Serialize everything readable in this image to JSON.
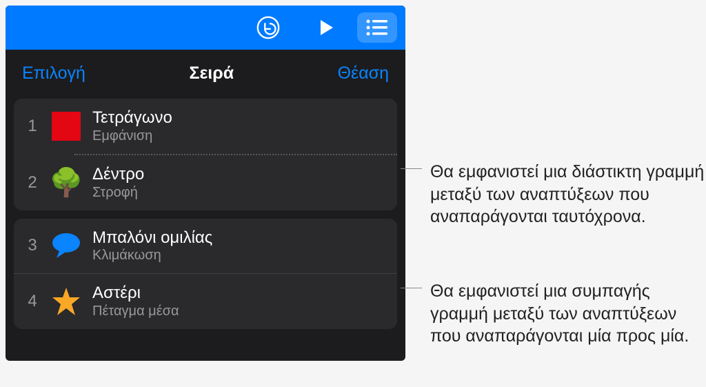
{
  "subheader": {
    "left": "Επιλογή",
    "center": "Σειρά",
    "right": "Θέαση"
  },
  "items": [
    {
      "number": "1",
      "title": "Τετράγωνο",
      "subtitle": "Εμφάνιση"
    },
    {
      "number": "2",
      "title": "Δέντρο",
      "subtitle": "Στροφή"
    },
    {
      "number": "3",
      "title": "Μπαλόνι ομιλίας",
      "subtitle": "Κλιμάκωση"
    },
    {
      "number": "4",
      "title": "Αστέρι",
      "subtitle": "Πέταγμα μέσα"
    }
  ],
  "callouts": {
    "dotted": "Θα εμφανιστεί μια διάστικτη γραμμή μεταξύ των αναπτύξεων που αναπαράγονται ταυτόχρονα.",
    "solid": "Θα εμφανιστεί μια συμπαγής γραμμή μεταξύ των αναπτύξεων που αναπαράγονται μία προς μία."
  }
}
